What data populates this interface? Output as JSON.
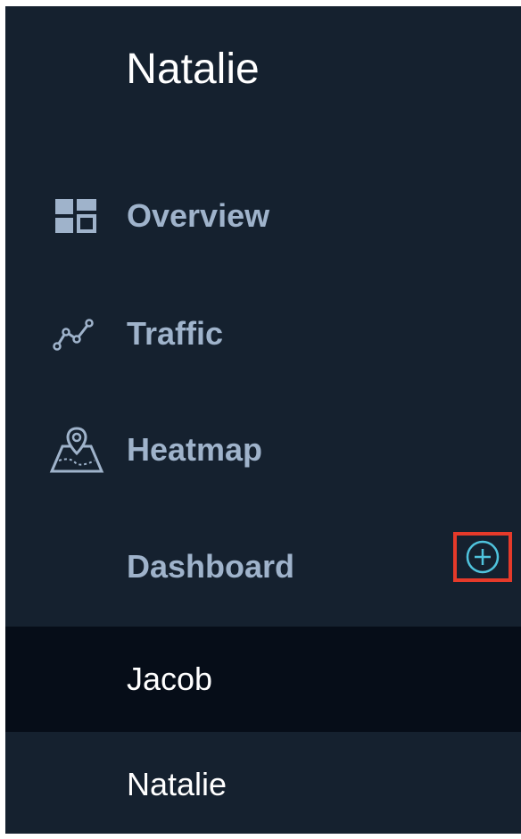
{
  "sidebar": {
    "title": "Natalie",
    "items": [
      {
        "label": "Overview",
        "icon": "dashboard-grid-icon"
      },
      {
        "label": "Traffic",
        "icon": "line-chart-icon"
      },
      {
        "label": "Heatmap",
        "icon": "map-pin-icon"
      },
      {
        "label": "Dashboard",
        "icon": "add-circle-icon"
      }
    ],
    "dashboards": [
      {
        "label": "Jacob",
        "active": true
      },
      {
        "label": "Natalie",
        "active": false
      }
    ]
  },
  "colors": {
    "panel_bg": "#15212f",
    "active_bg": "#060d18",
    "nav_text": "#9fb3cb",
    "accent": "#4fc3dd",
    "highlight_border": "#e53a2a"
  }
}
